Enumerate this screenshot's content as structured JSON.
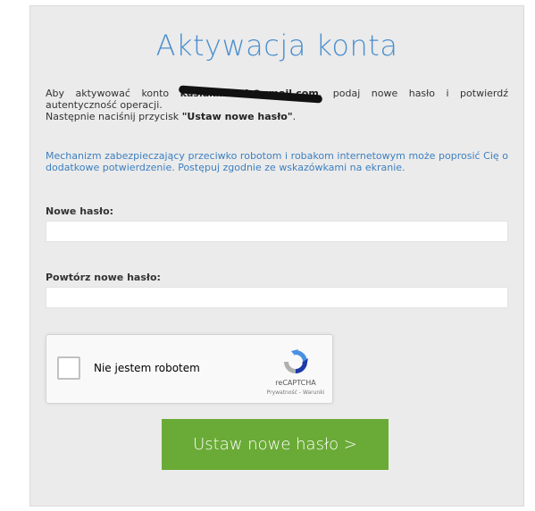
{
  "title": "Aktywacja konta",
  "intro": {
    "line1_prefix": "Aby aktywować konto",
    "email": "kasiakmiciek@gmail.com",
    "line1_suffix": ", podaj nowe hasło i potwierdź autentyczność operacji.",
    "line2_prefix": "Następnie naciśnij przycisk",
    "button_ref": "\"Ustaw nowe hasło\"",
    "line2_suffix": "."
  },
  "warning": "Mechanizm zabezpieczający przeciwko robotom i robakom internetowym może poprosić Cię o dodatkowe potwierdzenie. Postępuj zgodnie ze wskazówkami na ekranie.",
  "form": {
    "new_password_label": "Nowe hasło:",
    "new_password_value": "",
    "repeat_password_label": "Powtórz nowe hasło:",
    "repeat_password_value": ""
  },
  "captcha": {
    "checkbox_label": "Nie jestem robotem",
    "brand": "reCAPTCHA",
    "links": "Prywatność - Warunki",
    "checked": false
  },
  "submit_label": "Ustaw nowe hasło >",
  "colors": {
    "accent_blue": "#4a8fcf",
    "button_green": "#6aaa36",
    "panel_bg": "#ebebeb"
  }
}
